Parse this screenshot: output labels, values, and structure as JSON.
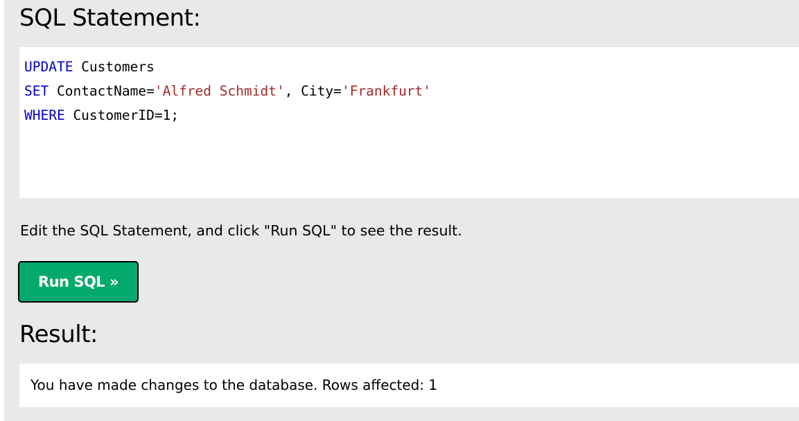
{
  "headings": {
    "sql_statement": "SQL Statement:",
    "result": "Result:"
  },
  "editor": {
    "lines": [
      [
        {
          "text": "UPDATE",
          "type": "keyword"
        },
        {
          "text": " Customers",
          "type": "plain"
        }
      ],
      [
        {
          "text": "SET",
          "type": "keyword"
        },
        {
          "text": " ContactName=",
          "type": "plain"
        },
        {
          "text": "'Alfred Schmidt'",
          "type": "string"
        },
        {
          "text": ", City=",
          "type": "plain"
        },
        {
          "text": "'Frankfurt'",
          "type": "string"
        }
      ],
      [
        {
          "text": "WHERE",
          "type": "keyword"
        },
        {
          "text": " CustomerID=1;",
          "type": "plain"
        }
      ]
    ]
  },
  "hint": "Edit the SQL Statement, and click \"Run SQL\" to see the result.",
  "run_button": {
    "label": "Run SQL »"
  },
  "result": {
    "message": "You have made changes to the database. Rows affected: 1"
  },
  "colors": {
    "panel_background": "#e7e9eb",
    "button_background": "#04aa6d",
    "sql_keyword": "#0000cd",
    "sql_string": "#a52a2a"
  }
}
